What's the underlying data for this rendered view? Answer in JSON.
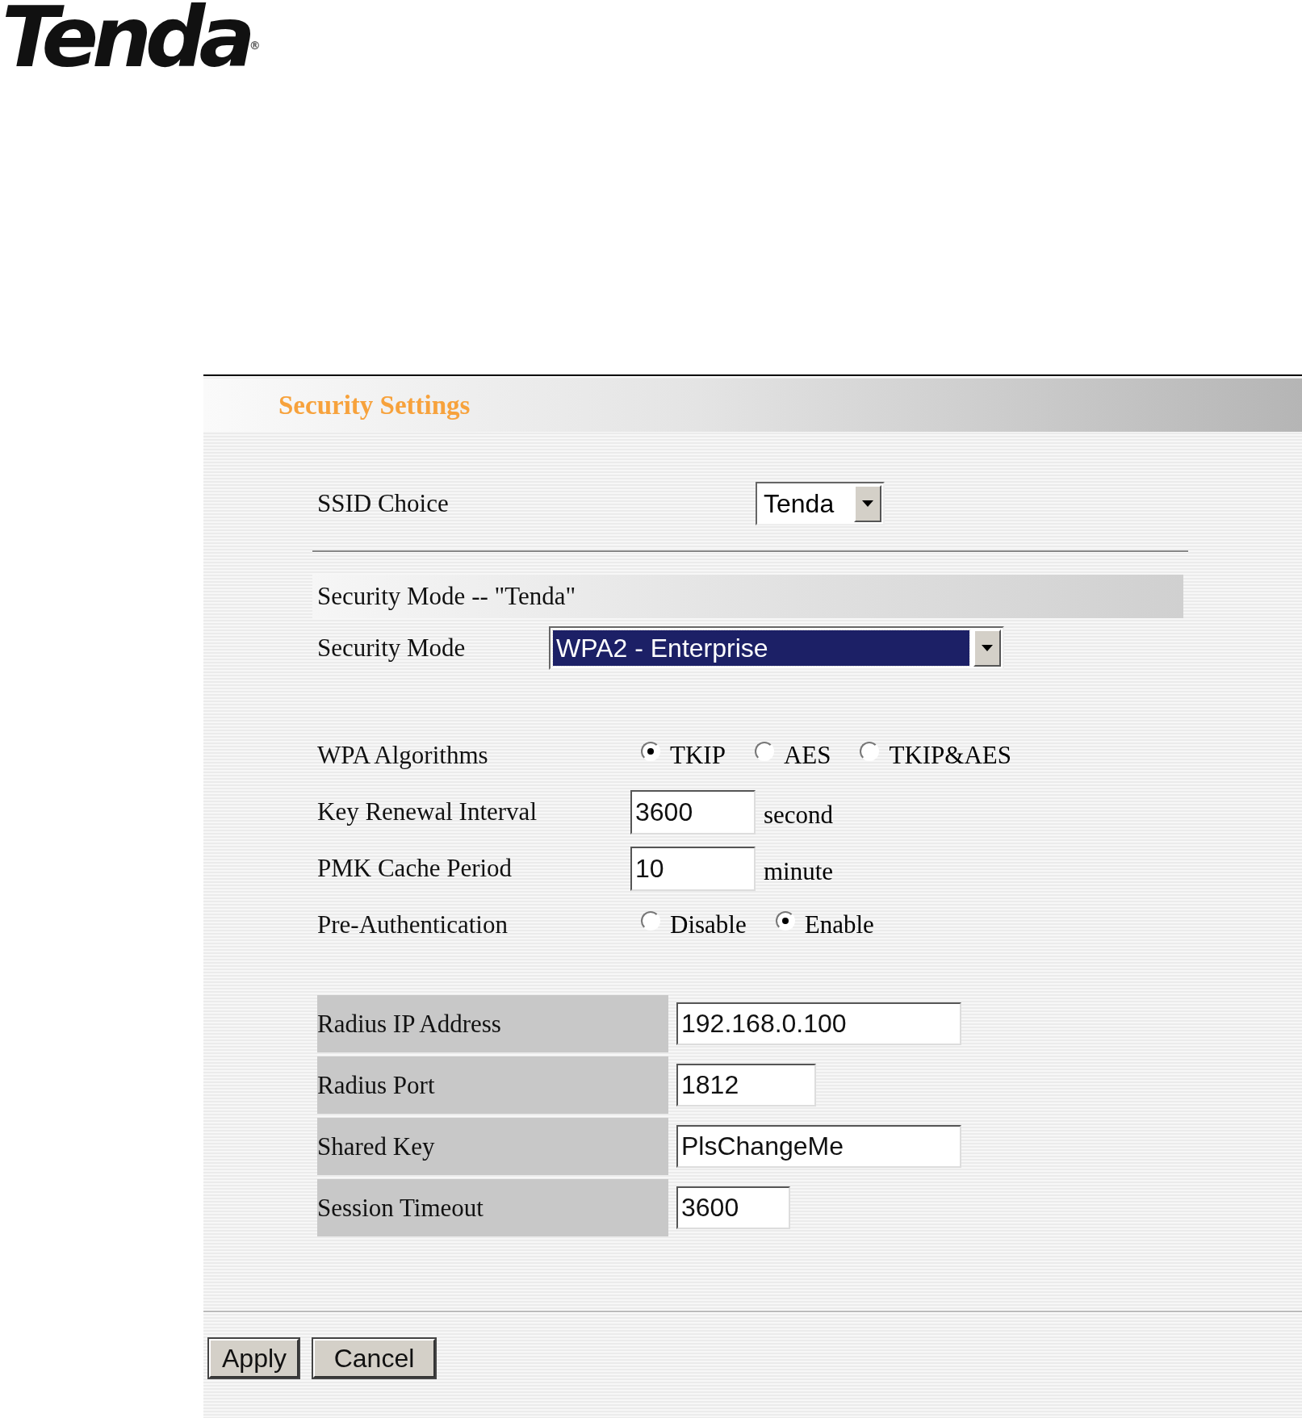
{
  "logo": {
    "text": "Tenda",
    "mark": "®"
  },
  "panel": {
    "title": "Security Settings"
  },
  "ssid_choice": {
    "label": "SSID Choice",
    "value": "Tenda"
  },
  "section_header": "Security Mode -- \"Tenda\"",
  "security_mode": {
    "label": "Security Mode",
    "value": "WPA2 - Enterprise"
  },
  "fields": [
    {
      "kind": "radio",
      "label": "WPA Algorithms",
      "options": [
        {
          "label": "TKIP",
          "selected": true
        },
        {
          "label": "AES",
          "selected": false
        },
        {
          "label": "TKIP&AES",
          "selected": false
        }
      ]
    },
    {
      "kind": "input",
      "label": "Key Renewal Interval",
      "value": "3600",
      "unit": "second"
    },
    {
      "kind": "input",
      "label": "PMK Cache Period",
      "value": "10",
      "unit": "minute"
    },
    {
      "kind": "radio",
      "label": "Pre-Authentication",
      "options": [
        {
          "label": "Disable",
          "selected": false
        },
        {
          "label": "Enable",
          "selected": true
        }
      ]
    }
  ],
  "radius": [
    {
      "label": "Radius IP Address",
      "value": "192.168.0.100"
    },
    {
      "label": "Radius Port",
      "value": "1812"
    },
    {
      "label": "Shared Key",
      "value": "PlsChangeMe"
    },
    {
      "label": "Session Timeout",
      "value": "3600"
    }
  ],
  "buttons": [
    "Apply",
    "Cancel"
  ]
}
